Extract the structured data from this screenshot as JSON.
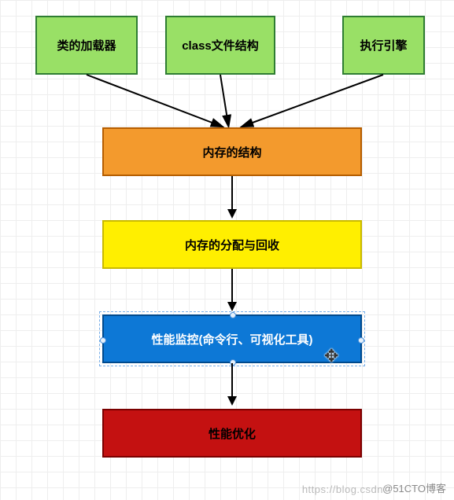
{
  "nodes": {
    "top1": {
      "label": "类的加载器"
    },
    "top2": {
      "label": "class文件结构"
    },
    "top3": {
      "label": "执行引擎"
    },
    "mem_struct": {
      "label": "内存的结构"
    },
    "mem_alloc": {
      "label": "内存的分配与回收"
    },
    "perf_mon": {
      "label": "性能监控(命令行、可视化工具)"
    },
    "perf_opt": {
      "label": "性能优化"
    }
  },
  "selection": {
    "node": "perf_mon",
    "cursor_visible": true
  },
  "watermarks": {
    "left": "https://blog.csdn",
    "right": "@51CTO博客"
  },
  "chart_data": {
    "type": "flowchart",
    "nodes": [
      {
        "id": "top1",
        "label": "类的加载器",
        "color": "green"
      },
      {
        "id": "top2",
        "label": "class文件结构",
        "color": "green"
      },
      {
        "id": "top3",
        "label": "执行引擎",
        "color": "green"
      },
      {
        "id": "mem_struct",
        "label": "内存的结构",
        "color": "orange"
      },
      {
        "id": "mem_alloc",
        "label": "内存的分配与回收",
        "color": "yellow"
      },
      {
        "id": "perf_mon",
        "label": "性能监控(命令行、可视化工具)",
        "color": "blue",
        "selected": true
      },
      {
        "id": "perf_opt",
        "label": "性能优化",
        "color": "red"
      }
    ],
    "edges": [
      {
        "from": "top1",
        "to": "mem_struct"
      },
      {
        "from": "top2",
        "to": "mem_struct"
      },
      {
        "from": "top3",
        "to": "mem_struct"
      },
      {
        "from": "mem_struct",
        "to": "mem_alloc"
      },
      {
        "from": "mem_alloc",
        "to": "perf_mon"
      },
      {
        "from": "perf_mon",
        "to": "perf_opt"
      }
    ]
  }
}
